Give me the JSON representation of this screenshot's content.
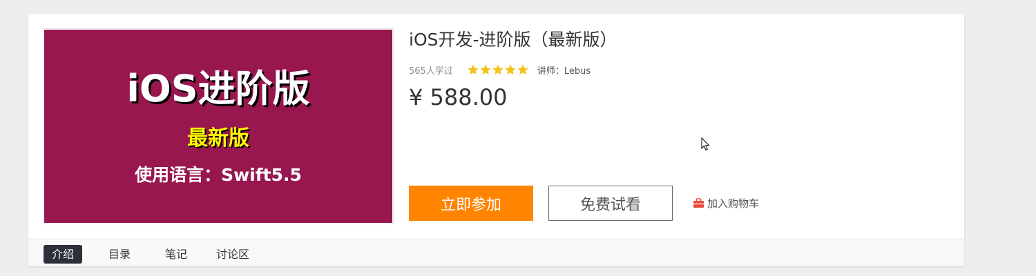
{
  "course": {
    "cover": {
      "title": "iOS进阶版",
      "badge": "最新版",
      "language_line": "使用语言：Swift5.5",
      "background_color": "#97174e"
    },
    "title": "iOS开发-进阶版（最新版）",
    "learners": "565人学过",
    "rating": {
      "stars": 5,
      "max": 5,
      "icon": "star-icon",
      "color": "#f5c218"
    },
    "teacher": "讲师：Lebus",
    "price": "¥ 588.00"
  },
  "actions": {
    "join_label": "立即参加",
    "join_color": "#ff8400",
    "trial_label": "免费试看",
    "cart_label": "加入购物车",
    "cart_icon": "shopping-basket-icon",
    "cart_icon_color": "#e84a3c"
  },
  "tabs": [
    {
      "label": "介绍",
      "active": true
    },
    {
      "label": "目录",
      "active": false
    },
    {
      "label": "笔记",
      "active": false
    },
    {
      "label": "讨论区",
      "active": false
    }
  ]
}
